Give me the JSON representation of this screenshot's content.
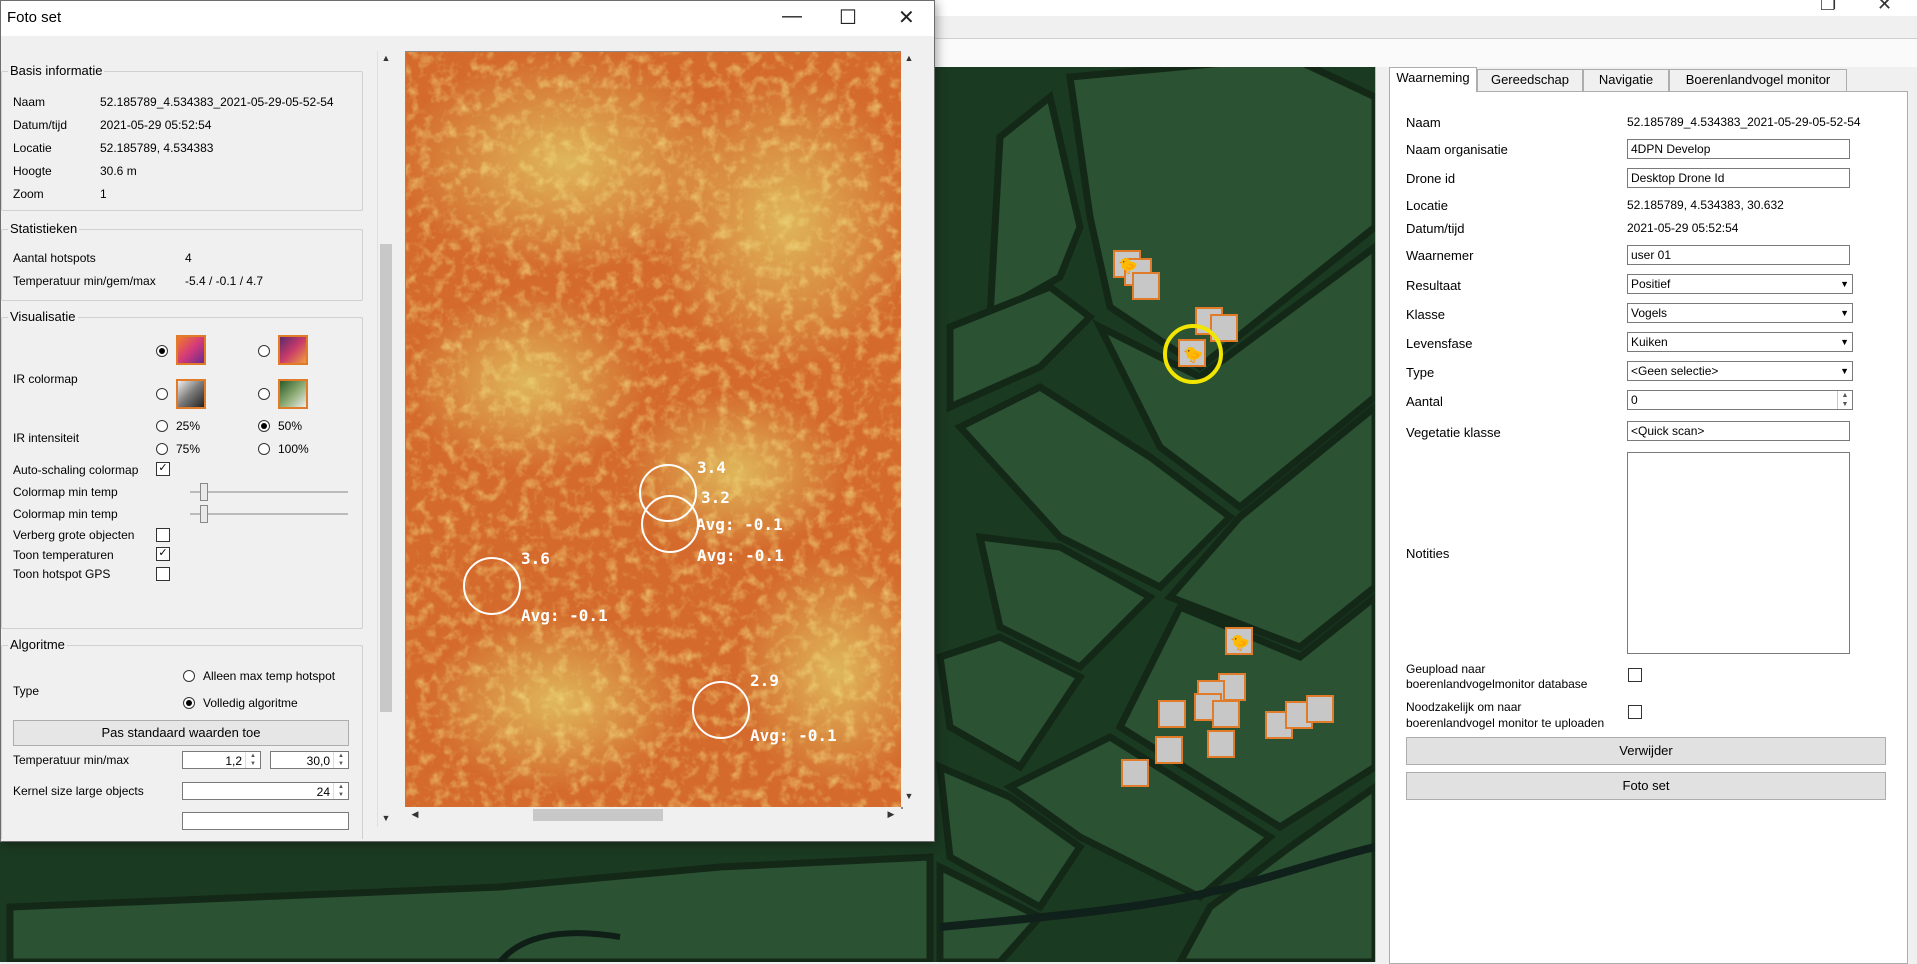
{
  "dialog": {
    "title": "Foto set",
    "basis": {
      "title": "Basis informatie",
      "rows": [
        {
          "label": "Naam",
          "value": "52.185789_4.534383_2021-05-29-05-52-54"
        },
        {
          "label": "Datum/tijd",
          "value": "2021-05-29 05:52:54"
        },
        {
          "label": "Locatie",
          "value": "52.185789, 4.534383"
        },
        {
          "label": "Hoogte",
          "value": "30.6 m"
        },
        {
          "label": "Zoom",
          "value": "1"
        }
      ]
    },
    "stats": {
      "title": "Statistieken",
      "rows": [
        {
          "label": "Aantal hotspots",
          "value": "4"
        },
        {
          "label": "Temperatuur min/gem/max",
          "value": "-5.4 / -0.1 / 4.7"
        }
      ]
    },
    "vis": {
      "title": "Visualisatie",
      "colormap_label": "IR colormap",
      "intensity_label": "IR intensiteit",
      "intensity_options": [
        "25%",
        "50%",
        "75%",
        "100%"
      ],
      "intensity_selected": "50%",
      "autoscale_label": "Auto-schaling colormap",
      "cmap_min_label": "Colormap min temp",
      "cmap_max_label": "Colormap min temp",
      "hide_large_label": "Verberg grote objecten",
      "show_temps_label": "Toon temperaturen",
      "show_gps_label": "Toon hotspot GPS",
      "autoscale_checked": true,
      "hide_large_checked": false,
      "show_temps_checked": true,
      "show_gps_checked": false
    },
    "algo": {
      "title": "Algoritme",
      "type_label": "Type",
      "opt1": "Alleen max temp hotspot",
      "opt2": "Volledig algoritme",
      "selected": "Volledig algoritme",
      "apply_button": "Pas standaard waarden toe",
      "temp_label": "Temperatuur min/max",
      "temp_min": "1,2",
      "temp_max": "30,0",
      "kernel_label": "Kernel size large objects",
      "kernel_value": "24"
    },
    "hotspots": [
      {
        "max": "3.4",
        "avg": "Avg: -0.1"
      },
      {
        "max": "3.2",
        "avg": "Avg: -0.1"
      },
      {
        "max": "3.6",
        "avg": "Avg: -0.1"
      },
      {
        "max": "2.9",
        "avg": "Avg: -0.1"
      }
    ]
  },
  "right": {
    "tabs": [
      "Waarneming",
      "Gereedschap",
      "Navigatie",
      "Boerenlandvogel monitor"
    ],
    "active_tab": "Waarneming",
    "naam_label": "Naam",
    "naam_value": "52.185789_4.534383_2021-05-29-05-52-54",
    "org_label": "Naam organisatie",
    "org_value": "4DPN Develop",
    "drone_label": "Drone id",
    "drone_value": "Desktop Drone Id",
    "locatie_label": "Locatie",
    "locatie_value": "52.185789, 4.534383, 30.632",
    "datum_label": "Datum/tijd",
    "datum_value": "2021-05-29 05:52:54",
    "waarnemer_label": "Waarnemer",
    "waarnemer_value": "user 01",
    "resultaat_label": "Resultaat",
    "resultaat_value": "Positief",
    "klasse_label": "Klasse",
    "klasse_value": "Vogels",
    "levensfase_label": "Levensfase",
    "levensfase_value": "Kuiken",
    "type_label": "Type",
    "type_value": "<Geen selectie>",
    "aantal_label": "Aantal",
    "aantal_value": "0",
    "veg_label": "Vegetatie klasse",
    "veg_value": "<Quick scan>",
    "notities_label": "Notities",
    "upload_label_1": "Geupload naar",
    "upload_label_2": "boerenlandvogelmonitor database",
    "nood_label_1": "Noodzakelijk om naar",
    "nood_label_2": "boerenlandvogel monitor te uploaden",
    "delete_button": "Verwijder",
    "fotoset_button": "Foto set"
  },
  "colors": {
    "accent_orange": "#e07b2a",
    "highlight_yellow": "#f2e600"
  }
}
